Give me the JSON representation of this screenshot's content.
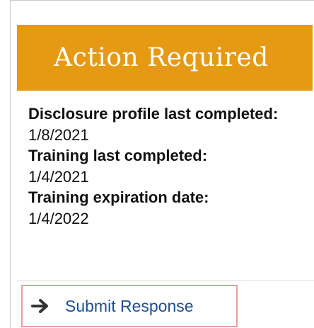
{
  "banner": {
    "title": "Action Required",
    "color": "#e69a14"
  },
  "details": {
    "disclosure_label": "Disclosure profile last completed:",
    "disclosure_value": "1/8/2021",
    "training_label": "Training last completed:",
    "training_value": "1/4/2021",
    "expiration_label": "Training expiration date:",
    "expiration_value": "1/4/2022"
  },
  "actions": {
    "submit_label": "Submit Response",
    "submit_icon": "arrow-right-icon",
    "link_color": "#1f4f8f"
  }
}
